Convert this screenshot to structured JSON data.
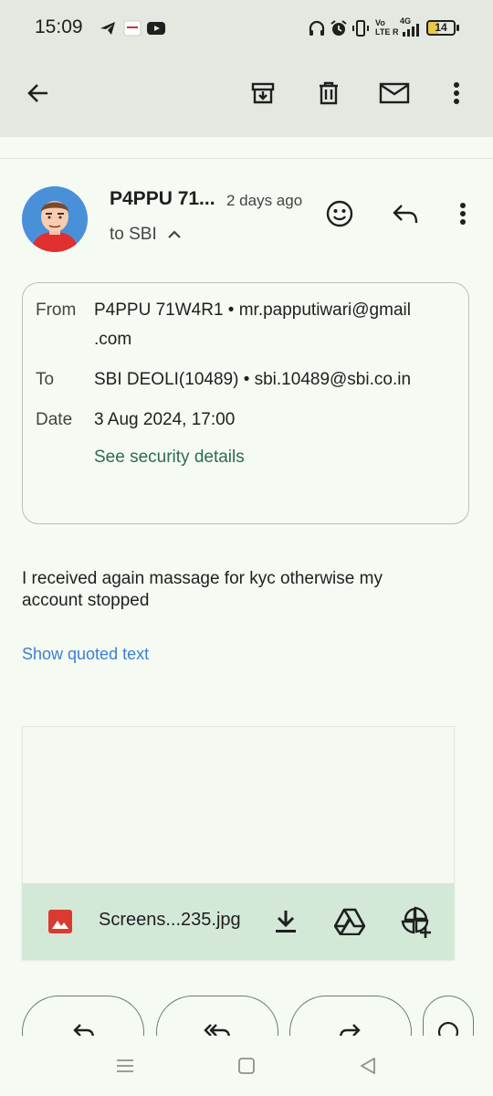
{
  "status_bar": {
    "time": "15:09",
    "battery": "14",
    "icons": [
      "telegram-icon",
      "app-thumbnail-icon",
      "youtube-icon",
      "headphones-icon",
      "alarm-icon",
      "vibrate-icon",
      "volte-icon",
      "signal-4g-icon",
      "battery-icon"
    ],
    "network": {
      "vo": "Vo",
      "lte": "LTE",
      "g4": "4G",
      "r": "R"
    }
  },
  "toolbar": {
    "icons": [
      "back-arrow-icon",
      "archive-icon",
      "delete-icon",
      "mark-unread-icon",
      "more-vert-icon"
    ]
  },
  "message": {
    "sender_name": "P4PPU 71...",
    "sent_ago": "2 days ago",
    "recipient_summary": "to SBI",
    "details": {
      "from_label": "From",
      "from_value": "P4PPU 71W4R1 • mr.papputiwari@gmail",
      "from_value_cont": ".com",
      "to_label": "To",
      "to_value": "SBI DEOLI(10489) • sbi.10489@sbi.co.in",
      "date_label": "Date",
      "date_value": "3 Aug 2024, 17:00",
      "security_link": "See security details"
    },
    "body_line1": "I received again massage for kyc otherwise my",
    "body_line2": "account stopped",
    "quoted_link": "Show quoted text"
  },
  "attachment": {
    "file_name": "Screens...235.jpg",
    "icons": [
      "image-file-icon",
      "download-icon",
      "drive-icon",
      "add-to-photos-icon"
    ]
  },
  "actions": [
    "reply-icon",
    "reply-all-icon",
    "forward-icon",
    "emoji-icon"
  ],
  "nav_bar": {
    "icons": [
      "menu-icon",
      "home-icon",
      "back-icon"
    ]
  },
  "colors": {
    "background": "#f5faf3",
    "appbar": "#e3e8e1",
    "link_green": "#2e6b4f",
    "link_blue": "#3d7fd0",
    "attachment_bar": "#d4e8d8"
  }
}
